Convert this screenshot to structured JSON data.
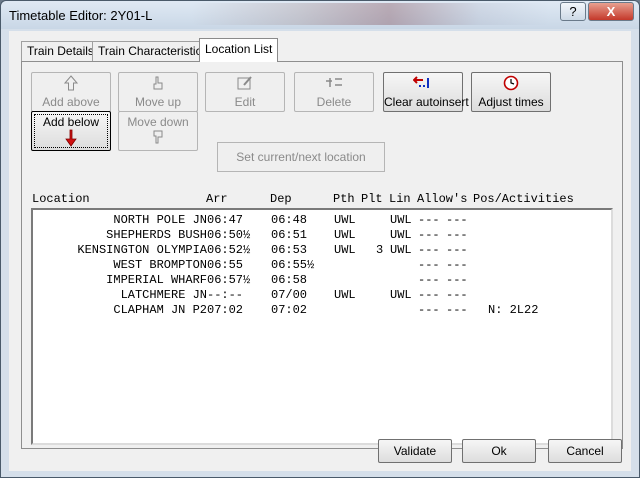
{
  "window": {
    "title": "Timetable Editor: 2Y01-L"
  },
  "titlebar_buttons": {
    "help": "?",
    "close": "X"
  },
  "tabs": [
    {
      "label": "Train Details",
      "mnemonic_index": 7
    },
    {
      "label": "Train Characteristics",
      "mnemonic_index": 8
    },
    {
      "label": "Location List",
      "active": true
    }
  ],
  "toolbar": {
    "add_above": "Add above",
    "move_up": "Move up",
    "edit": "Edit",
    "delete": "Delete",
    "clear_autoinsert": "Clear autoinsert",
    "adjust_times": "Adjust times",
    "add_below": "Add below",
    "move_down": "Move down",
    "set_current_next": "Set current/next location"
  },
  "columns": {
    "location": "Location",
    "arr": "Arr",
    "dep": "Dep",
    "pth": "Pth",
    "plt": "Plt",
    "lin": "Lin",
    "allows": "Allow's",
    "pos_activities": "Pos/Activities"
  },
  "rows": [
    {
      "location": "NORTH POLE JN",
      "arr": "06:47",
      "dep": "06:48",
      "pth": "UWL",
      "plt": "",
      "lin": "UWL",
      "allow1": "---",
      "allow2": "---",
      "pos": ""
    },
    {
      "location": "SHEPHERDS BUSH",
      "arr": "06:50½",
      "dep": "06:51",
      "pth": "UWL",
      "plt": "",
      "lin": "UWL",
      "allow1": "---",
      "allow2": "---",
      "pos": ""
    },
    {
      "location": "KENSINGTON OLYMPIA",
      "arr": "06:52½",
      "dep": "06:53",
      "pth": "UWL",
      "plt": "3",
      "lin": "UWL",
      "allow1": "---",
      "allow2": "---",
      "pos": ""
    },
    {
      "location": "WEST BROMPTON",
      "arr": "06:55",
      "dep": "06:55½",
      "pth": "",
      "plt": "",
      "lin": "",
      "allow1": "---",
      "allow2": "---",
      "pos": ""
    },
    {
      "location": "IMPERIAL WHARF",
      "arr": "06:57½",
      "dep": "06:58",
      "pth": "",
      "plt": "",
      "lin": "",
      "allow1": "---",
      "allow2": "---",
      "pos": ""
    },
    {
      "location": "LATCHMERE JN",
      "arr": "--:--",
      "dep": "07/00",
      "pth": "UWL",
      "plt": "",
      "lin": "UWL",
      "allow1": "---",
      "allow2": "---",
      "pos": ""
    },
    {
      "location": "CLAPHAM JN P2",
      "arr": "07:02",
      "dep": "07:02",
      "pth": "",
      "plt": "",
      "lin": "",
      "allow1": "---",
      "allow2": "---",
      "pos": "N: 2L22"
    }
  ],
  "footer": {
    "validate": "Validate",
    "ok": "Ok",
    "cancel": "Cancel"
  },
  "icons": {
    "add_above": "up-arrow-outline-icon",
    "move_up": "hand-up-icon",
    "edit": "edit-icon",
    "delete": "delete-icon",
    "clear_autoinsert": "clear-autoinsert-icon",
    "adjust_times": "clock-icon",
    "add_below": "down-arrow-red-icon",
    "move_down": "hand-down-icon"
  }
}
